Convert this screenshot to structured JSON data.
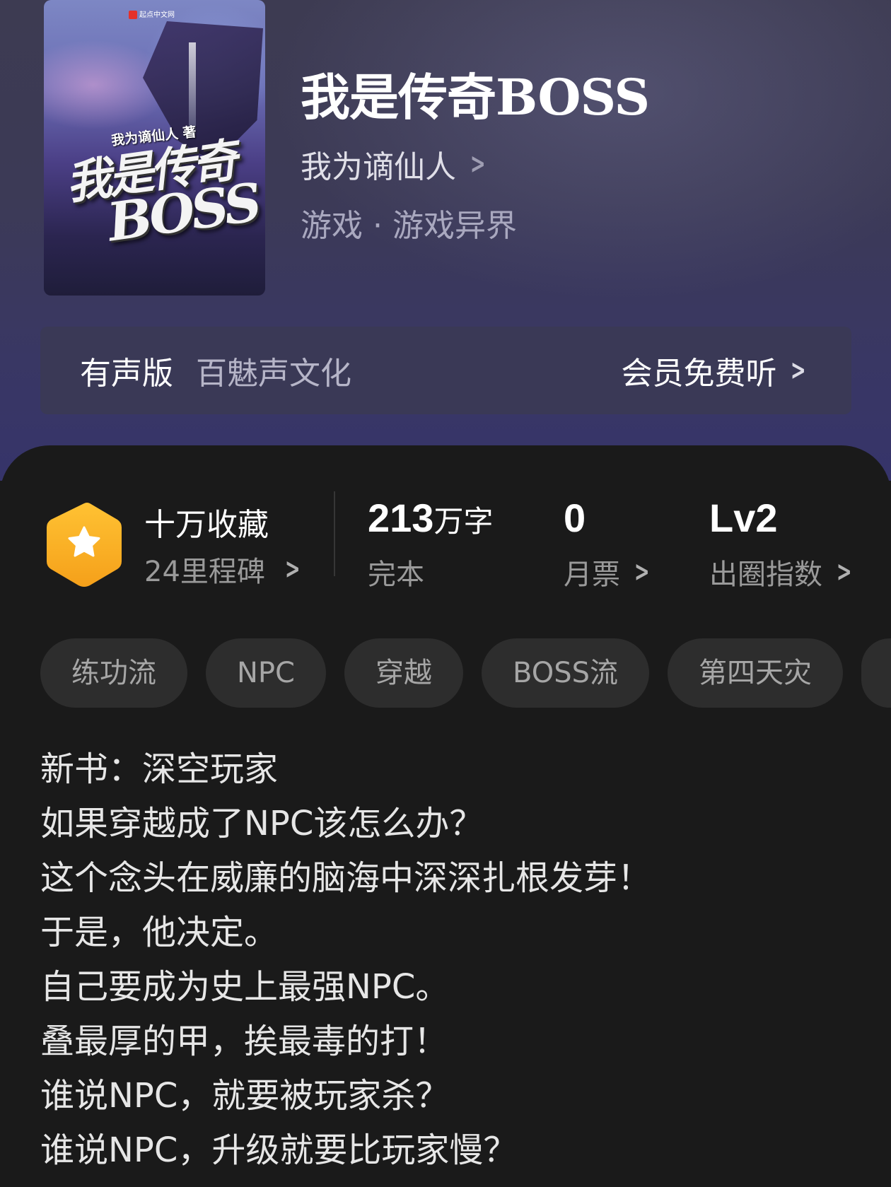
{
  "book": {
    "title": "我是传奇BOSS",
    "author": "我为谪仙人",
    "genre": "游戏 · 游戏异界"
  },
  "cover": {
    "publisher": "起点中文网",
    "author_line": "我为谪仙人 著",
    "title_line1": "我是传奇",
    "title_line2": "BOSS"
  },
  "audio": {
    "label": "有声版",
    "producer": "百魅声文化",
    "cta": "会员免费听"
  },
  "stats": {
    "collections": {
      "main": "十万收藏",
      "sub": "24里程碑"
    },
    "words": {
      "value": "213",
      "unit": "万字",
      "label": "完本"
    },
    "monthly_ticket": {
      "value": "0",
      "label": "月票"
    },
    "popularity": {
      "value": "Lv2",
      "label": "出圈指数"
    }
  },
  "tags": [
    "练功流",
    "NPC",
    "穿越",
    "BOSS流",
    "第四天灾"
  ],
  "description": [
    "新书：深空玩家",
    "如果穿越成了NPC该怎么办？",
    "这个念头在威廉的脑海中深深扎根发芽！",
    "于是，他决定。",
    "自己要成为史上最强NPC。",
    "叠最厚的甲，挨最毒的打！",
    "谁说NPC，就要被玩家杀？",
    "谁说NPC，升级就要比玩家慢？"
  ],
  "colors": {
    "header_bg": "#3c3a56",
    "audio_bar_bg": "#3a3956",
    "body_bg": "#1a1a1a",
    "badge": "#f5a623",
    "tag_bg": "#2d2d2d"
  },
  "icons": {
    "badge": "star-hexagon-icon",
    "chevron": "chevron-right-icon"
  }
}
